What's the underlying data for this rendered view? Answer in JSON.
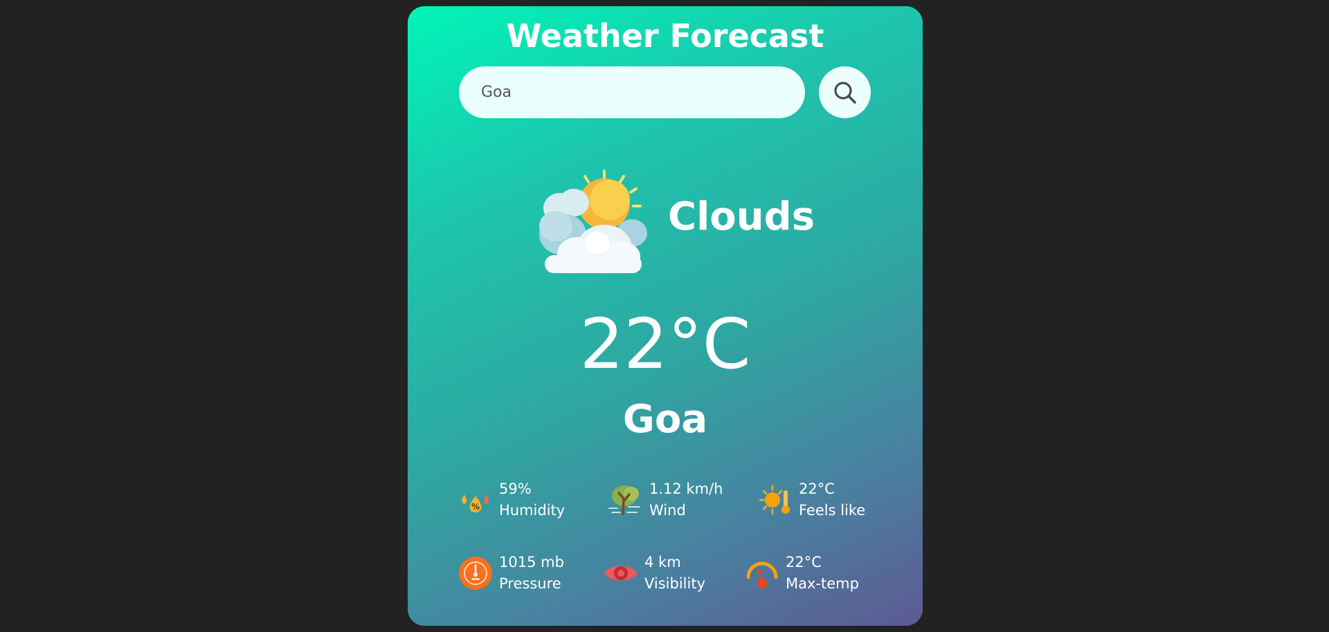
{
  "header": {
    "title": "Weather Forecast"
  },
  "search": {
    "value": "Goa",
    "placeholder": ""
  },
  "current": {
    "condition": "Clouds",
    "temperature": "22°C",
    "city": "Goa"
  },
  "details": [
    {
      "value": "59%",
      "label": "Humidity",
      "icon": "humidity-icon"
    },
    {
      "value": "1.12 km/h",
      "label": "Wind",
      "icon": "wind-icon"
    },
    {
      "value": "22°C",
      "label": "Feels like",
      "icon": "feels-like-icon"
    },
    {
      "value": "1015 mb",
      "label": "Pressure",
      "icon": "pressure-icon"
    },
    {
      "value": "4 km",
      "label": "Visibility",
      "icon": "visibility-icon"
    },
    {
      "value": "22°C",
      "label": "Max-temp",
      "icon": "max-temp-icon"
    }
  ],
  "colors": {
    "background": "#222222",
    "gradient_start": "#00f5b8",
    "gradient_end": "#5d5a93",
    "search_bg": "#ebfffc"
  }
}
